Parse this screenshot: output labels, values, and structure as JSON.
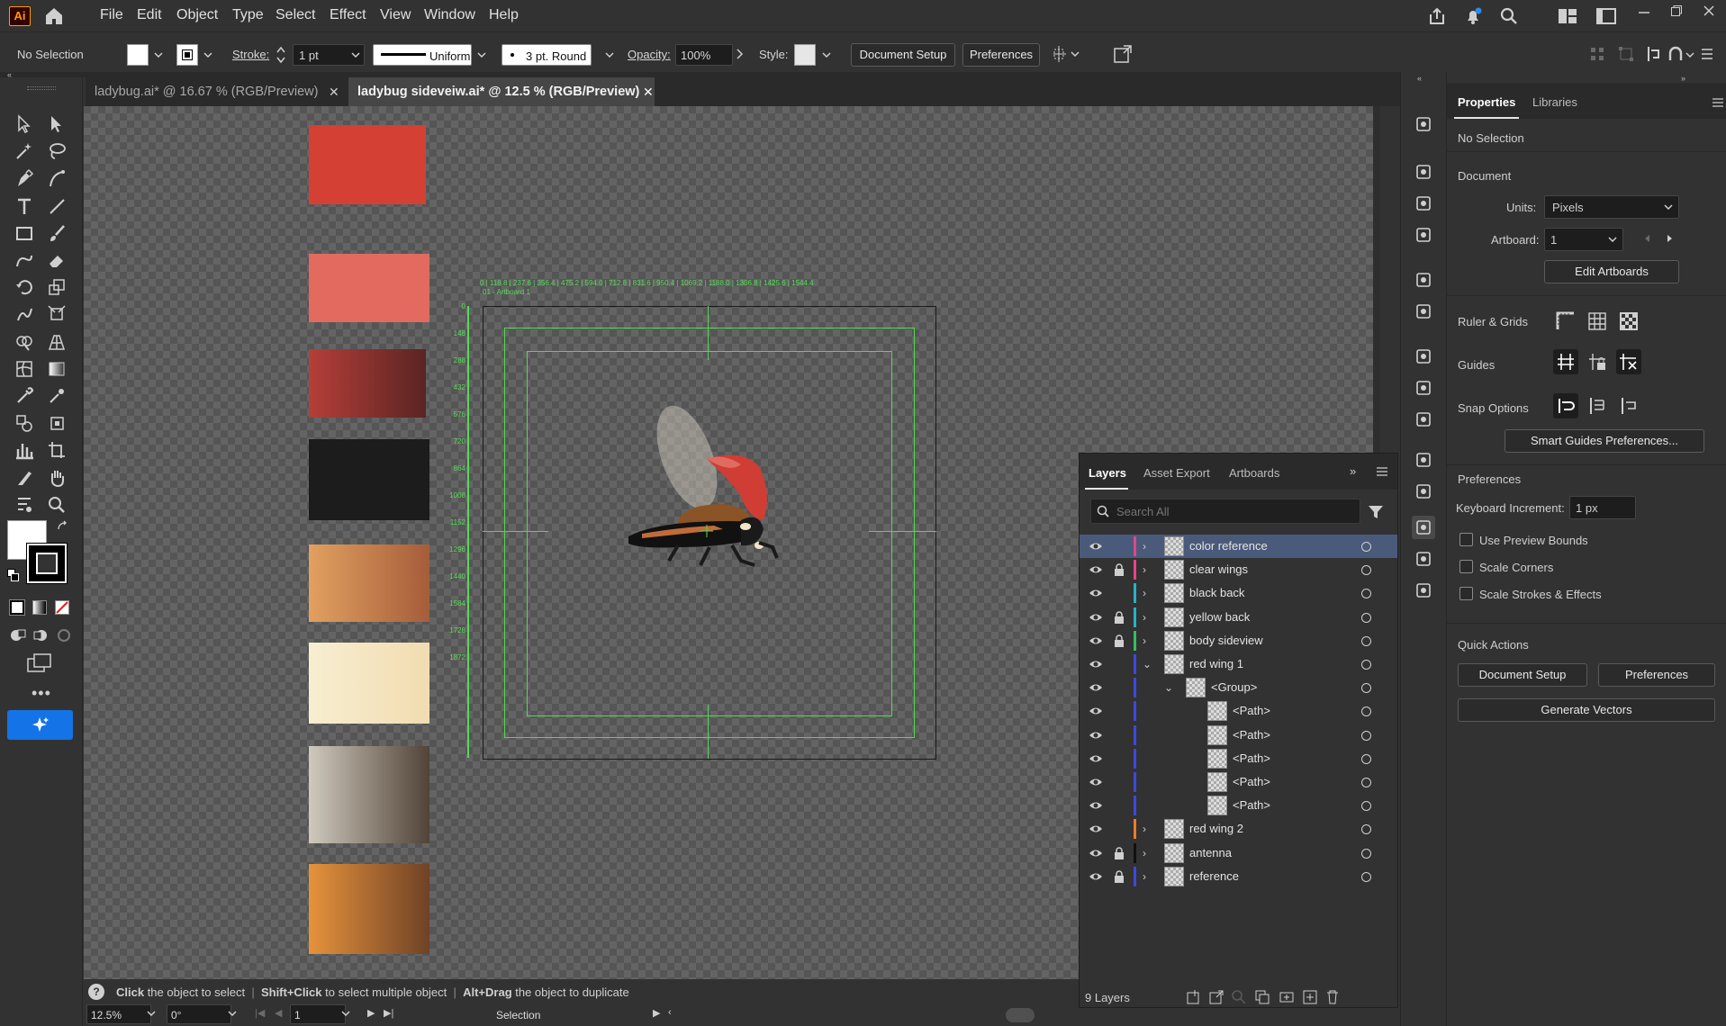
{
  "app": {
    "logo": "Ai"
  },
  "menu": [
    "File",
    "Edit",
    "Object",
    "Type",
    "Select",
    "Effect",
    "View",
    "Window",
    "Help"
  ],
  "control": {
    "selection": "No Selection",
    "stroke_label": "Stroke:",
    "stroke_value": "1 pt",
    "profile": "Uniform",
    "brush": "3 pt. Round",
    "opacity_label": "Opacity:",
    "opacity_value": "100%",
    "style_label": "Style:",
    "doc_setup": "Document Setup",
    "preferences": "Preferences"
  },
  "tabs": [
    {
      "title": "ladybug.ai* @ 16.67 % (RGB/Preview)",
      "active": false
    },
    {
      "title": "ladybug sideveiw.ai* @ 12.5 % (RGB/Preview)",
      "active": true
    }
  ],
  "canvas": {
    "swatch_colors": [
      "#d54034",
      "#e36a5f",
      "#b63e38",
      "#1c1c1c",
      "#e2a060",
      "#f7eed1",
      "#cfc9bd",
      "#e6923c"
    ],
    "artboard_label": "01 - Artboard 1",
    "ruler_x": "0 | 118.8 | 237.6 | 356.4 | 475.2 | 594.0 | 712.8 | 831.6 | 950.4 | 1069.2 | 1188.0 | 1306.8 | 1425.6 | 1544.4",
    "ruler_y": [
      "0",
      "148",
      "288",
      "432",
      "576",
      "720",
      "864",
      "1008",
      "1152",
      "1296",
      "1440",
      "1584",
      "1728",
      "1872"
    ]
  },
  "hint": {
    "part1_bold": "Click",
    "part1": " the object to select",
    "part2_bold": "Shift+Click",
    "part2": " to select multiple object",
    "part3_bold": "Alt+Drag",
    "part3": " the object to duplicate"
  },
  "status": {
    "zoom": "12.5%",
    "rotate": "0°",
    "artboard": "1",
    "tool": "Selection"
  },
  "layers_panel": {
    "tabs": [
      "Layers",
      "Asset Export",
      "Artboards"
    ],
    "search_placeholder": "Search All",
    "rows": [
      {
        "name": "color reference",
        "lock": false,
        "color": "#e8428a",
        "expanded": false,
        "depth": 0,
        "selected": true
      },
      {
        "name": "clear wings",
        "lock": true,
        "color": "#e8428a",
        "expanded": false,
        "depth": 0
      },
      {
        "name": "black back",
        "lock": false,
        "color": "#21b5c9",
        "expanded": false,
        "depth": 0
      },
      {
        "name": "yellow back",
        "lock": true,
        "color": "#21b5c9",
        "expanded": false,
        "depth": 0
      },
      {
        "name": "body sideview",
        "lock": true,
        "color": "#2fc05f",
        "expanded": false,
        "depth": 0
      },
      {
        "name": "red wing 1",
        "lock": false,
        "color": "#3b49e0",
        "expanded": true,
        "depth": 0
      },
      {
        "name": "<Group>",
        "lock": false,
        "color": "#3b49e0",
        "expanded": true,
        "depth": 1
      },
      {
        "name": "<Path>",
        "lock": false,
        "color": "#3b49e0",
        "depth": 2
      },
      {
        "name": "<Path>",
        "lock": false,
        "color": "#3b49e0",
        "depth": 2
      },
      {
        "name": "<Path>",
        "lock": false,
        "color": "#3b49e0",
        "depth": 2
      },
      {
        "name": "<Path>",
        "lock": false,
        "color": "#3b49e0",
        "depth": 2
      },
      {
        "name": "<Path>",
        "lock": false,
        "color": "#3b49e0",
        "depth": 2
      },
      {
        "name": "red wing 2",
        "lock": false,
        "color": "#f07b22",
        "expanded": false,
        "depth": 0
      },
      {
        "name": "antenna",
        "lock": true,
        "color": "#111111",
        "expanded": false,
        "depth": 0
      },
      {
        "name": "reference",
        "lock": true,
        "color": "#3b49e0",
        "expanded": false,
        "depth": 0
      }
    ],
    "count": "9 Layers"
  },
  "properties": {
    "tabs": [
      "Properties",
      "Libraries"
    ],
    "selection": "No Selection",
    "document_header": "Document",
    "units_label": "Units:",
    "units_value": "Pixels",
    "artboard_label": "Artboard:",
    "artboard_value": "1",
    "edit_artboards": "Edit Artboards",
    "ruler_grids": "Ruler & Grids",
    "guides": "Guides",
    "snap_options": "Snap Options",
    "smart_guides": "Smart Guides Preferences...",
    "prefs_header": "Preferences",
    "kb_increment_label": "Keyboard Increment:",
    "kb_increment_value": "1 px",
    "use_preview_bounds": "Use Preview Bounds",
    "scale_corners": "Scale Corners",
    "scale_strokes": "Scale Strokes & Effects",
    "quick_actions": "Quick Actions",
    "doc_setup": "Document Setup",
    "preferences": "Preferences",
    "generate_vectors": "Generate Vectors"
  }
}
